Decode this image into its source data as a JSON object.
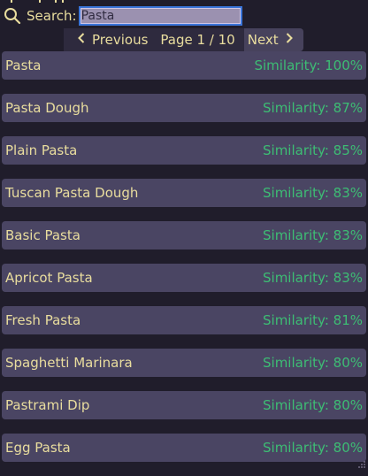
{
  "search": {
    "label": "Search:",
    "value": "Pasta",
    "icon": "search-icon"
  },
  "pagination": {
    "previous_label": "Previous",
    "next_label": "Next",
    "page_text": "Page 1 / 10",
    "current_page": 1,
    "total_pages": 10
  },
  "results": [
    {
      "name": "Pasta",
      "similarity": "Similarity: 100%"
    },
    {
      "name": "Pasta Dough",
      "similarity": "Similarity: 87%"
    },
    {
      "name": "Plain Pasta",
      "similarity": "Similarity: 85%"
    },
    {
      "name": "Tuscan Pasta Dough",
      "similarity": "Similarity: 83%"
    },
    {
      "name": "Basic Pasta",
      "similarity": "Similarity: 83%"
    },
    {
      "name": "Apricot Pasta",
      "similarity": "Similarity: 83%"
    },
    {
      "name": "Fresh Pasta",
      "similarity": "Similarity: 81%"
    },
    {
      "name": "Spaghetti Marinara",
      "similarity": "Similarity: 80%"
    },
    {
      "name": "Pastrami Dip",
      "similarity": "Similarity: 80%"
    },
    {
      "name": "Egg Pasta",
      "similarity": "Similarity: 80%"
    }
  ],
  "colors": {
    "background": "#201d2b",
    "row": "#4a4563",
    "text": "#e9dd9e",
    "similarity": "#3dbd74",
    "input_border": "#3a74d8"
  }
}
